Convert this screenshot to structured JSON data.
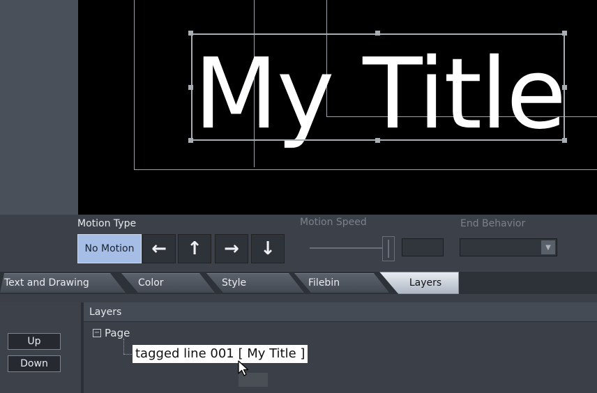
{
  "preview": {
    "title_text": "My Title"
  },
  "motion": {
    "type_label": "Motion Type",
    "speed_label": "Motion Speed",
    "end_label": "End Behavior",
    "no_motion_label": "No Motion",
    "speed_value": "",
    "end_value": "",
    "arrows": [
      "left-arrow-icon",
      "up-arrow-icon",
      "right-arrow-icon",
      "down-arrow-icon"
    ]
  },
  "tabs": [
    {
      "label": "Text and Drawing"
    },
    {
      "label": "Color"
    },
    {
      "label": "Style"
    },
    {
      "label": "Filebin"
    },
    {
      "label": "Layers",
      "active": true
    }
  ],
  "layers": {
    "header": "Layers",
    "up_label": "Up",
    "down_label": "Down",
    "tree": {
      "toggle": "−",
      "page_label": "Page",
      "item_label": "tagged line 001 [ My Title ]"
    }
  },
  "colors": {
    "active_button": "#a6bde6",
    "preview_bg": "#000000",
    "panel_bg": "#3b4048"
  }
}
